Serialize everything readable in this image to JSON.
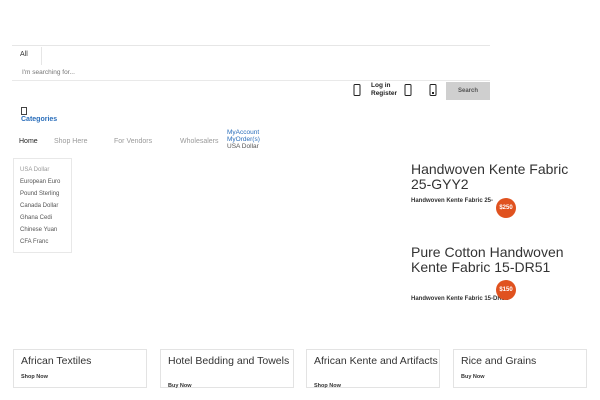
{
  "header": {
    "category_tab": "All",
    "search_placeholder": "I'm searching for...",
    "login_line1": "Log in",
    "login_line2": "Register",
    "search_button": "Search"
  },
  "categories": {
    "label": "Categories"
  },
  "nav": {
    "home": "Home",
    "shop": "Shop Here",
    "vendors": "For Vendors",
    "wholesalers": "Wholesalers",
    "my_account": "MyAccount",
    "my_orders": "MyOrder(s)",
    "currency": "USA Dollar"
  },
  "currencies": [
    "USA Dollar",
    "European Euro",
    "Pound Sterling",
    "Canada Dollar",
    "Ghana Cedi",
    "Chinese Yuan",
    "CFA Franc"
  ],
  "products": [
    {
      "title": "Handwoven Kente Fabric 25-GYY2",
      "subtitle": "Handwoven Kente Fabric 25-",
      "price": "$250"
    },
    {
      "title": "Pure Cotton Handwoven Kente Fabric 15-DR51",
      "subtitle": "Handwoven Kente Fabric 15-DR51",
      "price": "$150"
    }
  ],
  "cards": [
    {
      "title": "African Textiles",
      "cta": "Shop Now"
    },
    {
      "title": "Hotel Bedding and Towels",
      "cta": "Buy Now"
    },
    {
      "title": "African Kente and Artifacts",
      "cta": "Shop Now"
    },
    {
      "title": "Rice and Grains",
      "cta": "Buy Now"
    }
  ],
  "colors": {
    "accent": "#2a6ebb",
    "badge": "#e0521f",
    "button": "#cfcfcf"
  }
}
